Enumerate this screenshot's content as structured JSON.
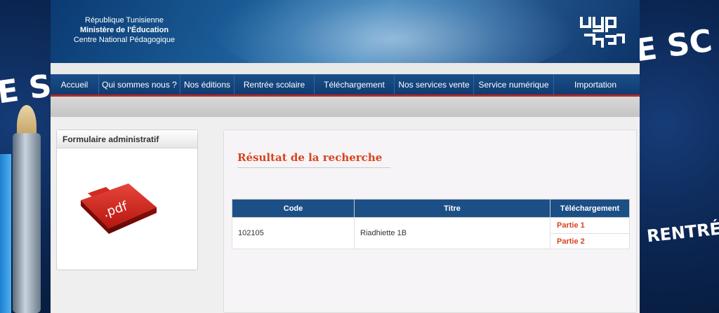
{
  "header": {
    "line1": "République Tunisienne",
    "line2": "Ministère de l'Éducation",
    "line3": "Centre National Pédagogique",
    "logo_icon": "cnp-logo-icon"
  },
  "background": {
    "left_text": "E SC",
    "right_text_top": "E SC",
    "right_text_bottom": "RENTRÉ"
  },
  "nav": {
    "items": [
      {
        "label": "Accueil"
      },
      {
        "label": "Qui sommes nous ?"
      },
      {
        "label": "Nos éditions"
      },
      {
        "label": "Rentrée scolaire"
      },
      {
        "label": "Téléchargement"
      },
      {
        "label": "Nos services vente"
      },
      {
        "label": "Service numérique"
      },
      {
        "label": "Importation"
      }
    ]
  },
  "sidebar": {
    "title": "Formulaire administratif",
    "icon": "pdf-icon",
    "icon_text": ".pdf"
  },
  "main": {
    "title": "Résultat de la recherche",
    "table": {
      "headers": {
        "code": "Code",
        "title": "Titre",
        "download": "Téléchargement"
      },
      "rows": [
        {
          "code": "102105",
          "title": "Riadhiette 1B",
          "parts": [
            "Partie 1",
            "Partie 2"
          ]
        }
      ]
    }
  },
  "colors": {
    "nav_blue": "#0f3b70",
    "accent_red": "#d9431e",
    "table_header": "#1c4f86"
  }
}
